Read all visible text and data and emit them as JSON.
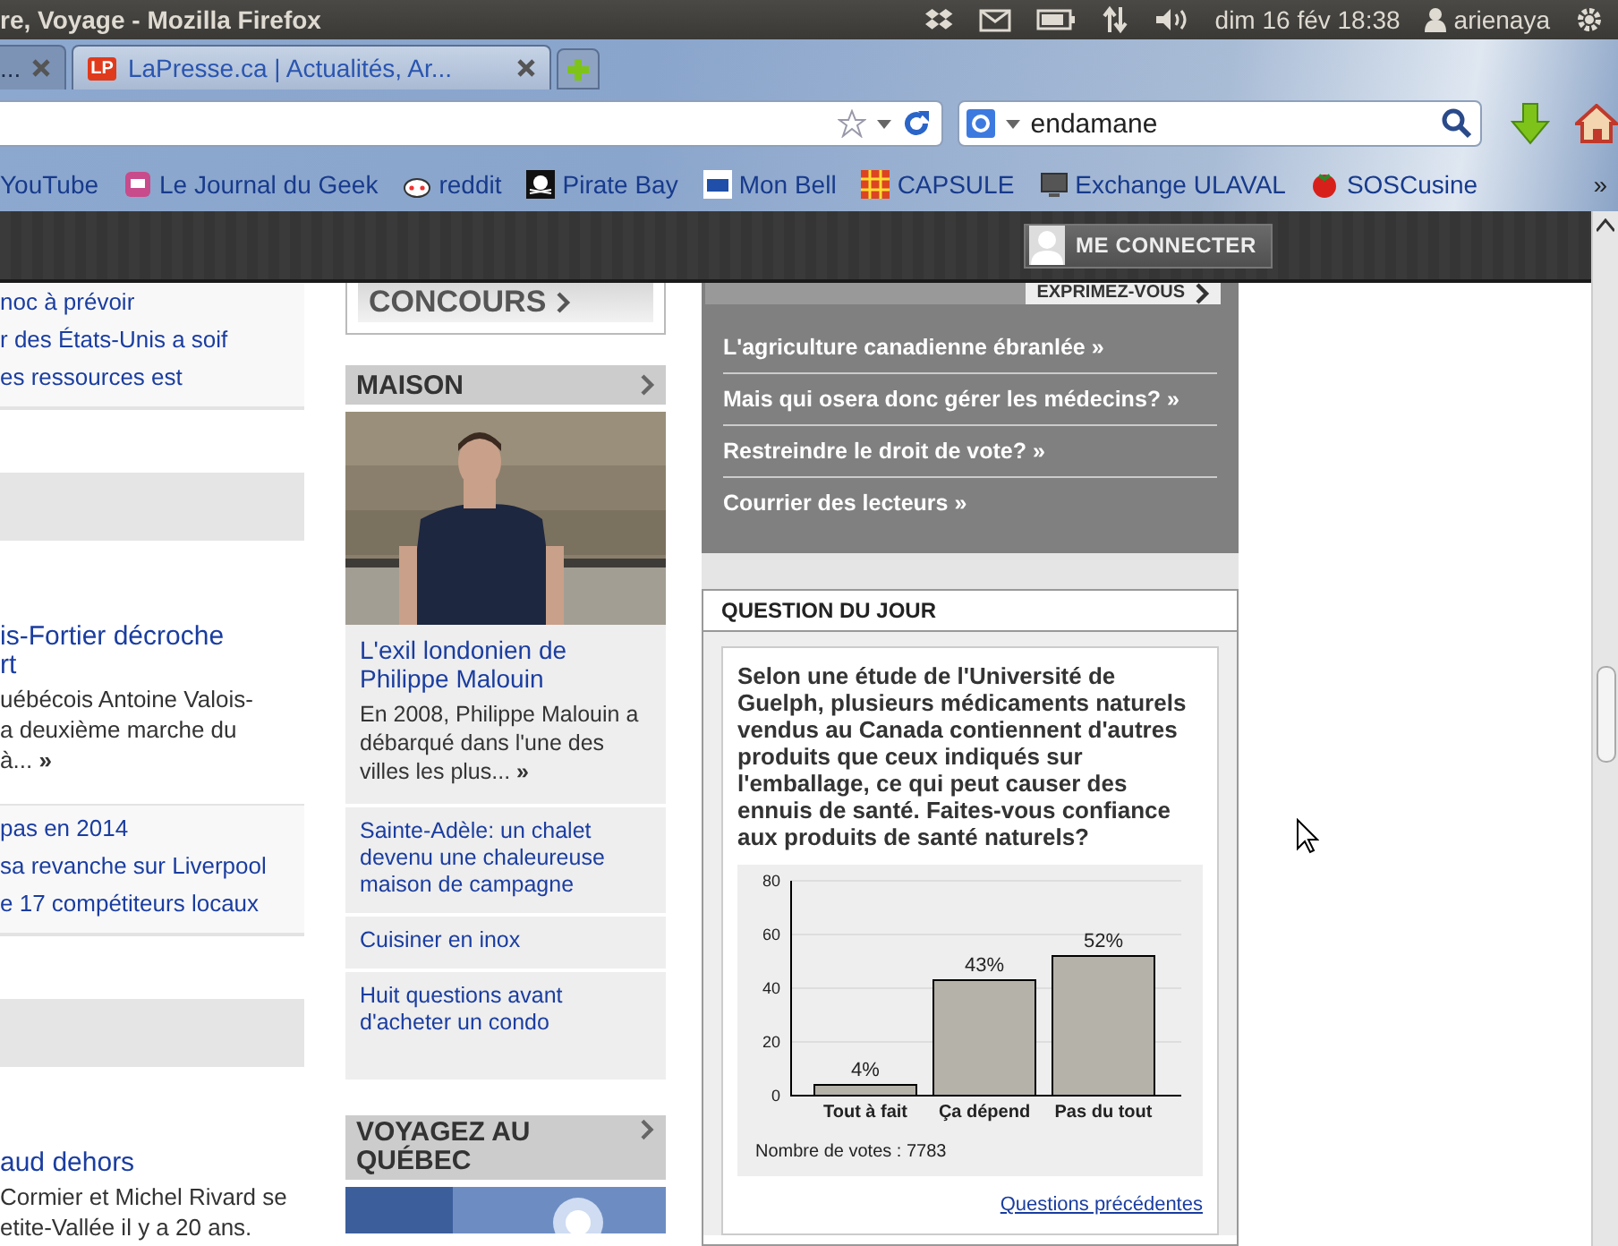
{
  "panel": {
    "window_title": "re, Voyage - Mozilla Firefox",
    "clock": "dim 16 fév 18:38",
    "user": "arienaya"
  },
  "tabs": [
    {
      "label": "...",
      "selected": false
    },
    {
      "label": "LaPresse.ca | Actualités, Ar...",
      "favicon": "LP",
      "selected": true
    }
  ],
  "navigation": {
    "search_value": "endamane"
  },
  "bookmarks": [
    {
      "label": "YouTube",
      "kind": "plain"
    },
    {
      "label": "Le Journal du Geek",
      "kind": "robot"
    },
    {
      "label": "reddit",
      "kind": "alien"
    },
    {
      "label": "Pirate Bay",
      "kind": "skull"
    },
    {
      "label": "Mon Bell",
      "kind": "logo"
    },
    {
      "label": "CAPSULE",
      "kind": "grid"
    },
    {
      "label": "Exchange ULAVAL",
      "kind": "screen"
    },
    {
      "label": "SOSCusine",
      "kind": "tomato"
    }
  ],
  "bookmarks_more": "»",
  "site_bar": {
    "login_button": "ME CONNECTER"
  },
  "left_column": [
    {
      "kind": "link_list",
      "links": [
        "noc à prévoir",
        "r des États-Unis a soif",
        "es ressources est"
      ]
    },
    {
      "kind": "gray_bar"
    },
    {
      "kind": "story",
      "title": [
        "is-Fortier décroche",
        "rt"
      ],
      "summary": [
        "uébécois Antoine Valois-",
        "a deuxième marche du",
        "à... **»**"
      ]
    },
    {
      "kind": "link_list",
      "links": [
        "pas en 2014",
        "sa revanche sur Liverpool",
        "e 17 compétiteurs locaux"
      ]
    },
    {
      "kind": "gray_bar"
    },
    {
      "kind": "story",
      "title": [
        "aud dehors"
      ],
      "summary": [
        "Cormier et Michel Rivard se",
        "etite-Vallée il y a 20 ans."
      ]
    }
  ],
  "middle_column": {
    "banner": "CONCOURS",
    "maison": {
      "header": "MAISON",
      "feature_title": "L'exil londonien de Philippe Malouin",
      "feature_summary": "En 2008, Philippe Malouin a débarqué dans l'une des villes les plus... **»**",
      "links": [
        "Sainte-Adèle: un chalet devenu une chaleureuse maison de campagne",
        "Cuisiner en inox",
        "Huit questions avant d'acheter un condo"
      ]
    },
    "voyagez": {
      "header": "VOYAGEZ AU QUÉBEC"
    }
  },
  "opinion": {
    "tab": "EXPRIMEZ-VOUS",
    "links": [
      "L'agriculture canadienne ébranlée »",
      "Mais qui osera donc gérer les médecins? »",
      "Restreindre le droit de vote? »",
      "Courrier des lecteurs »"
    ]
  },
  "poll": {
    "header": "QUESTION DU JOUR",
    "question": "Selon une étude de l'Université de Guelph, plusieurs médicaments naturels vendus au Canada contiennent d'autres produits que ceux indiqués sur l'emballage, ce qui peut causer des ennuis de santé. Faites-vous confiance aux produits de santé naturels?",
    "chart_data": {
      "type": "bar",
      "categories": [
        "Tout à fait",
        "Ça dépend",
        "Pas du tout"
      ],
      "values": [
        4,
        43,
        52
      ],
      "ylim": [
        0,
        80
      ],
      "grid": true,
      "yticks": [
        0,
        20,
        40,
        60,
        80
      ],
      "value_labels": [
        "4%",
        "43%",
        "52%"
      ]
    },
    "votes": "Nombre de votes : 7783",
    "link": "Questions précédentes"
  }
}
